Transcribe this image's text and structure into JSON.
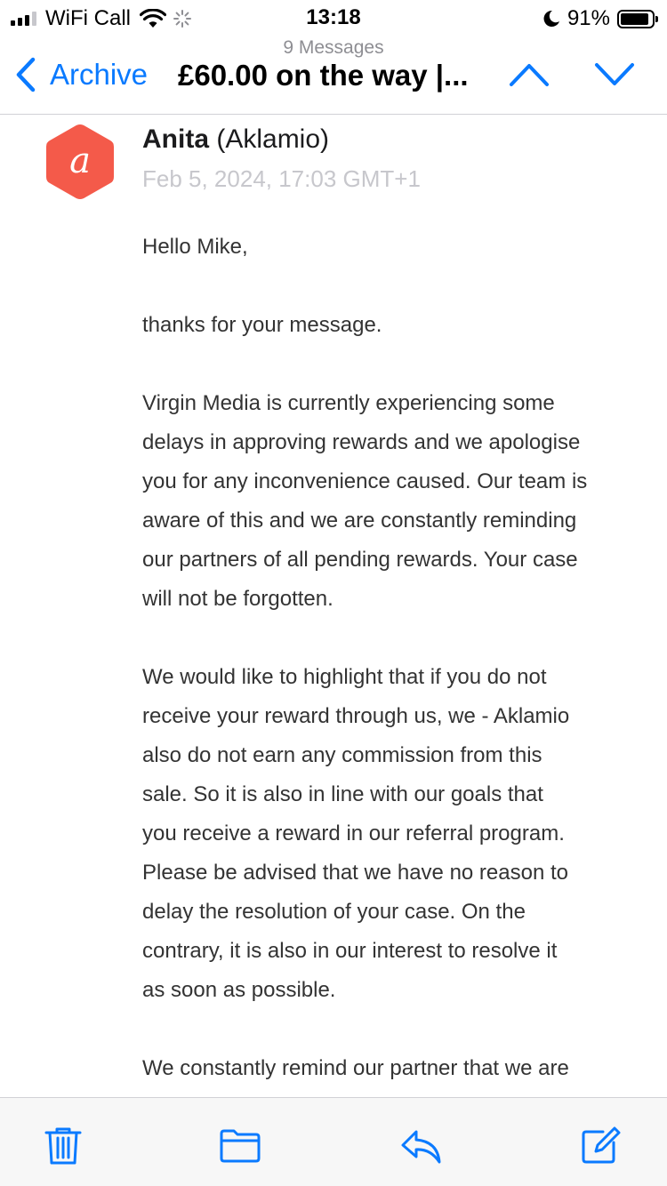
{
  "status_bar": {
    "carrier": "WiFi Call",
    "time": "13:18",
    "battery_percent": "91%",
    "battery_level": 0.91,
    "signal_bars_active": 3,
    "signal_bars_total": 4
  },
  "nav": {
    "message_count": "9 Messages",
    "back_label": "Archive",
    "title": "£60.00  on the way |...",
    "accent_color": "#0a7aff"
  },
  "message": {
    "sender_name": "Anita",
    "sender_org": "(Aklamio)",
    "date": "Feb 5, 2024, 17:03 GMT+1",
    "avatar": {
      "icon": "aklamio-logo-icon",
      "letter": "a",
      "color": "#f45a4a"
    },
    "body": [
      [
        "Hello Mike,"
      ],
      [
        "thanks for your message."
      ],
      [
        "Virgin Media is currently experiencing some",
        "delays in approving rewards and we apologise",
        "you for any inconvenience caused. Our team is",
        "aware of this and we are constantly reminding",
        "our partners of all pending rewards. Your case",
        "will not be forgotten."
      ],
      [
        "We would like to highlight that if you do not",
        "receive your reward through us, we - Aklamio",
        "also do not earn any commission from this",
        "sale. So it is also in line with our goals that",
        "you receive a reward in our referral program.",
        "Please be advised that we have no reason to",
        "delay the resolution of your case. On the",
        "contrary, it is also in our interest to resolve it",
        "as soon as possible."
      ],
      [
        "We constantly remind our partner that we are"
      ]
    ]
  },
  "toolbar": {
    "icons": [
      "trash-icon",
      "folder-icon",
      "reply-icon",
      "compose-icon"
    ]
  }
}
